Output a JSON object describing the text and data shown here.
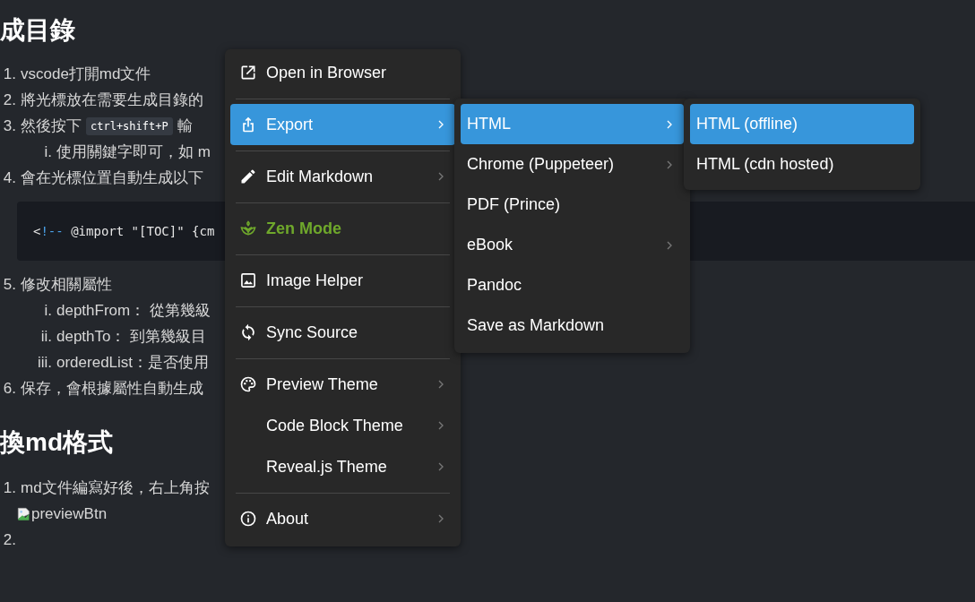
{
  "document": [
    {
      "kind": "heading",
      "text": "成目錄"
    },
    {
      "kind": "item",
      "marker": "1.",
      "text": "vscode打開md文件"
    },
    {
      "kind": "item",
      "marker": "2.",
      "text": "將光標放在需要生成目錄的"
    },
    {
      "kind": "item",
      "marker": "3.",
      "text": "然後按下",
      "code": "ctrl+shift+P",
      "after": "輸"
    },
    {
      "kind": "subitem",
      "marker": "i.",
      "text": "使用關鍵字即可，如 m"
    },
    {
      "kind": "item",
      "marker": "4.",
      "text": "會在光標位置自動生成以下"
    },
    {
      "kind": "code",
      "parts": [
        {
          "kind": "punct",
          "text": "<"
        },
        {
          "kind": "comment",
          "text": "!--"
        },
        {
          "kind": "plain",
          "text": " @import \"[TOC]\" {cm"
        }
      ]
    },
    {
      "kind": "item",
      "marker": "5.",
      "text": "修改相關屬性"
    },
    {
      "kind": "subitem",
      "marker": "i.",
      "text": "depthFrom： 從第幾級"
    },
    {
      "kind": "subitem",
      "marker": "ii.",
      "text": "depthTo： 到第幾級目"
    },
    {
      "kind": "subitem",
      "marker": "iii.",
      "text": "orderedList：是否使用"
    },
    {
      "kind": "item",
      "marker": "6.",
      "text": "保存，會根據屬性自動生成"
    },
    {
      "kind": "heading",
      "text": "換md格式"
    },
    {
      "kind": "item",
      "marker": "1.",
      "text": "md文件編寫好後，右上角按"
    },
    {
      "kind": "image",
      "alt": "previewBtn"
    },
    {
      "kind": "item",
      "marker": "2."
    }
  ],
  "context_menu": {
    "items": [
      {
        "kind": "item",
        "label": "Open in Browser",
        "submenu": false,
        "selected": false,
        "on": false
      },
      {
        "kind": "separator"
      },
      {
        "kind": "item",
        "label": "Export",
        "submenu": true,
        "selected": true,
        "on": false
      },
      {
        "kind": "separator"
      },
      {
        "kind": "item",
        "label": "Edit Markdown",
        "submenu": true,
        "selected": false,
        "on": false
      },
      {
        "kind": "separator"
      },
      {
        "kind": "item",
        "label": "Zen Mode",
        "submenu": false,
        "selected": false,
        "on": true
      },
      {
        "kind": "separator"
      },
      {
        "kind": "item",
        "label": "Image Helper",
        "submenu": false,
        "selected": false,
        "on": false
      },
      {
        "kind": "separator"
      },
      {
        "kind": "item",
        "label": "Sync Source",
        "submenu": false,
        "selected": false,
        "on": false
      },
      {
        "kind": "separator"
      },
      {
        "kind": "item",
        "label": "Preview Theme",
        "submenu": true,
        "selected": false,
        "on": false
      },
      {
        "kind": "item",
        "label": "Code Block Theme",
        "submenu": true,
        "selected": false,
        "on": false
      },
      {
        "kind": "item",
        "label": "Reveal.js Theme",
        "submenu": true,
        "selected": false,
        "on": false
      },
      {
        "kind": "separator"
      },
      {
        "kind": "item",
        "label": "About",
        "submenu": true,
        "selected": false,
        "on": false
      }
    ]
  },
  "export_submenu": {
    "items": [
      {
        "label": "HTML",
        "submenu": true,
        "selected": true
      },
      {
        "label": "Chrome (Puppeteer)",
        "submenu": true,
        "selected": false
      },
      {
        "label": "PDF (Prince)",
        "submenu": false,
        "selected": false
      },
      {
        "label": "eBook",
        "submenu": true,
        "selected": false
      },
      {
        "label": "Pandoc",
        "submenu": false,
        "selected": false
      },
      {
        "label": "Save as Markdown",
        "submenu": false,
        "selected": false
      }
    ]
  },
  "html_submenu": {
    "items": [
      {
        "label": "HTML (offline)",
        "submenu": false,
        "selected": true
      },
      {
        "label": "HTML (cdn hosted)",
        "submenu": false,
        "selected": false
      }
    ]
  }
}
